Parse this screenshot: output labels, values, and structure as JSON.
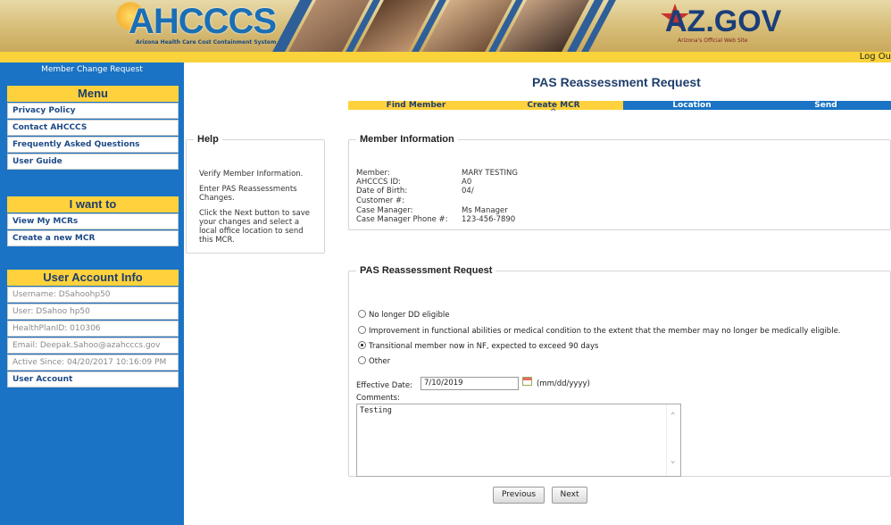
{
  "header": {
    "logo_text": "AHCCCS",
    "logo_subtitle": "Arizona Health Care Cost Containment System",
    "azgov_text": "AZ.GOV",
    "azgov_subtitle": "Arizona's Official Web Site",
    "logout_label": "Log Ou"
  },
  "sidebar": {
    "title": "Member Change Request",
    "menu": {
      "heading": "Menu",
      "items": [
        "Privacy Policy",
        "Contact AHCCCS",
        "Frequently Asked Questions",
        "User Guide"
      ]
    },
    "iwant": {
      "heading": "I want to",
      "items": [
        "View My MCRs",
        "Create a new MCR"
      ]
    },
    "account": {
      "heading": "User Account Info",
      "username": "Username: DSahoohp50",
      "user": "User: DSahoo hp50",
      "healthplan": "HealthPlanID: 010306",
      "email": "Email: Deepak.Sahoo@azahcccs.gov",
      "active_since": "Active Since: 04/20/2017 10:16:09 PM",
      "user_account_link": "User Account"
    }
  },
  "main": {
    "title": "PAS Reassessment Request",
    "steps": [
      "Find Member",
      "Create MCR",
      "Location",
      "Send"
    ],
    "help": {
      "legend": "Help",
      "p1": "Verify Member Information.",
      "p2": "Enter PAS Reassessments Changes.",
      "p3": "Click the Next button to save your changes and select a local office location to send this MCR."
    },
    "member": {
      "legend": "Member Information",
      "labels": [
        "Member:",
        "AHCCCS ID:",
        "Date of Birth:",
        "Customer #:",
        "Case Manager:",
        "Case Manager Phone #:"
      ],
      "values": [
        "MARY TESTING",
        "A0",
        "04/",
        "",
        "Ms Manager",
        "123-456-7890"
      ]
    },
    "pas": {
      "legend": "PAS Reassessment Request",
      "options": [
        "No longer DD eligible",
        "Improvement in functional abilities or medical condition to the extent that the member may no longer be medically eligible.",
        "Transitional member now in NF, expected to exceed 90 days",
        "Other"
      ],
      "selected_index": 2,
      "effective_date_label": "Effective Date:",
      "effective_date_value": "7/10/2019",
      "date_format": "(mm/dd/yyyy)",
      "comments_label": "Comments:",
      "comments_value": "Testing"
    },
    "buttons": {
      "previous": "Previous",
      "next": "Next"
    }
  }
}
